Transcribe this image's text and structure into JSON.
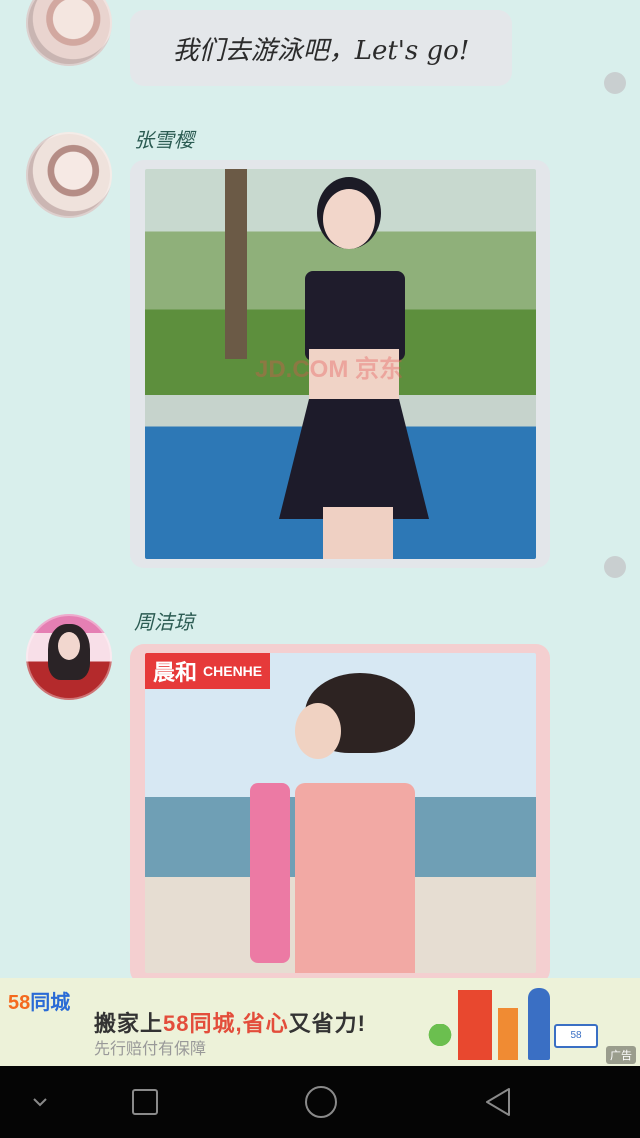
{
  "chat": {
    "messages": [
      {
        "type": "text",
        "text": "我们去游泳吧，Let's   go!"
      },
      {
        "type": "image",
        "sender": "张雪樱",
        "watermark": "JD.COM 京东"
      },
      {
        "type": "image",
        "sender": "周洁琼",
        "logo_cn": "晨和",
        "logo_en": "CHENHE"
      }
    ]
  },
  "ad": {
    "brand_number": "58",
    "brand_text": "同城",
    "headline_pre": "搬家上",
    "headline_brand": "58同城,",
    "headline_mid": "省心",
    "headline_post": "又省力!",
    "subline": "先行赔付有保障",
    "truck_label": "58",
    "tag": "广告",
    "colors": {
      "accent_orange": "#f46a1e",
      "accent_blue": "#2a6bd6",
      "accent_red": "#e34d3b"
    }
  },
  "navbar": {
    "buttons": [
      {
        "name": "collapse-button",
        "icon": "chevron-down-icon"
      },
      {
        "name": "recents-button",
        "icon": "square-icon"
      },
      {
        "name": "home-button",
        "icon": "circle-icon"
      },
      {
        "name": "back-button",
        "icon": "triangle-back-icon"
      }
    ]
  }
}
